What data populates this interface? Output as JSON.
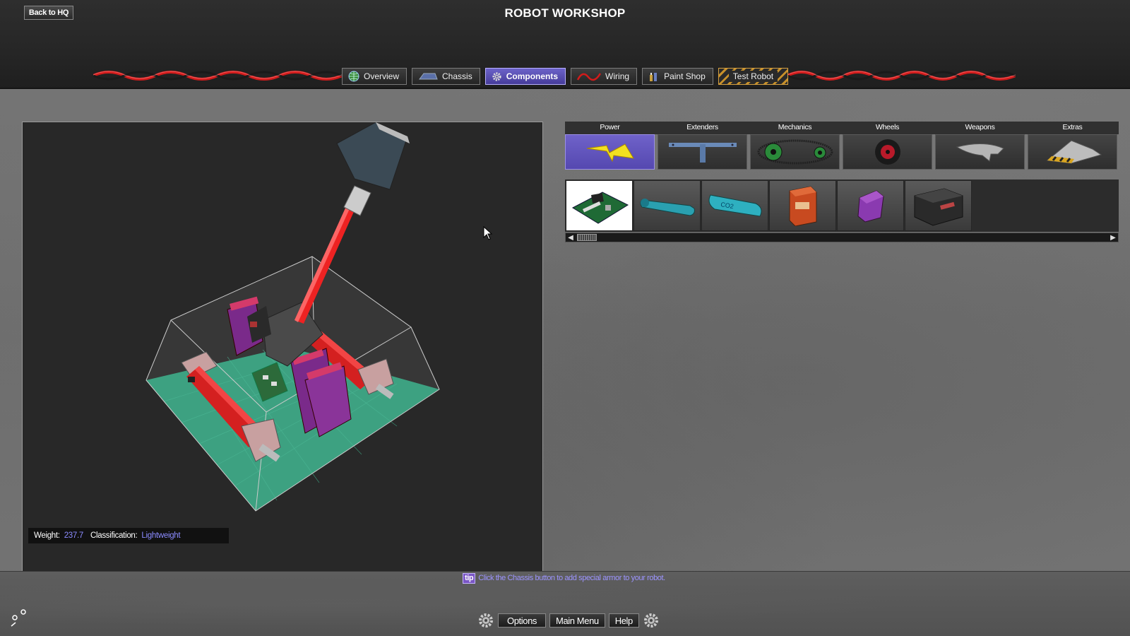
{
  "header": {
    "back_label": "Back to HQ",
    "title": "ROBOT WORKSHOP"
  },
  "tabs": [
    {
      "label": "Overview",
      "icon": "globe-icon"
    },
    {
      "label": "Chassis",
      "icon": "chassis-icon"
    },
    {
      "label": "Components",
      "icon": "gear-icon",
      "active": true
    },
    {
      "label": "Wiring",
      "icon": "wire-icon"
    },
    {
      "label": "Paint Shop",
      "icon": "paint-icon"
    },
    {
      "label": "Test Robot",
      "icon": ""
    }
  ],
  "viewport": {
    "weight_label": "Weight:",
    "weight_value": "237.7",
    "class_label": "Classification:",
    "class_value": "Lightweight"
  },
  "categories": [
    {
      "label": "Power",
      "icon": "lightning-icon",
      "active": true
    },
    {
      "label": "Extenders",
      "icon": "extender-icon"
    },
    {
      "label": "Mechanics",
      "icon": "belt-icon"
    },
    {
      "label": "Wheels",
      "icon": "wheel-icon"
    },
    {
      "label": "Weapons",
      "icon": "blade-icon"
    },
    {
      "label": "Extras",
      "icon": "ramp-icon"
    }
  ],
  "items": [
    {
      "name": "circuit-board",
      "selected": true
    },
    {
      "name": "teal-tank"
    },
    {
      "name": "co2-tank"
    },
    {
      "name": "orange-battery"
    },
    {
      "name": "purple-battery"
    },
    {
      "name": "black-battery"
    }
  ],
  "tip": {
    "badge": "tip",
    "text": "Click the Chassis button to add special armor to your robot."
  },
  "footer": {
    "options_label": "Options",
    "main_menu_label": "Main Menu",
    "help_label": "Help"
  },
  "colors": {
    "accent": "#6c63c9",
    "value_blue": "#8b8bff",
    "hazard": "#c7902a"
  }
}
